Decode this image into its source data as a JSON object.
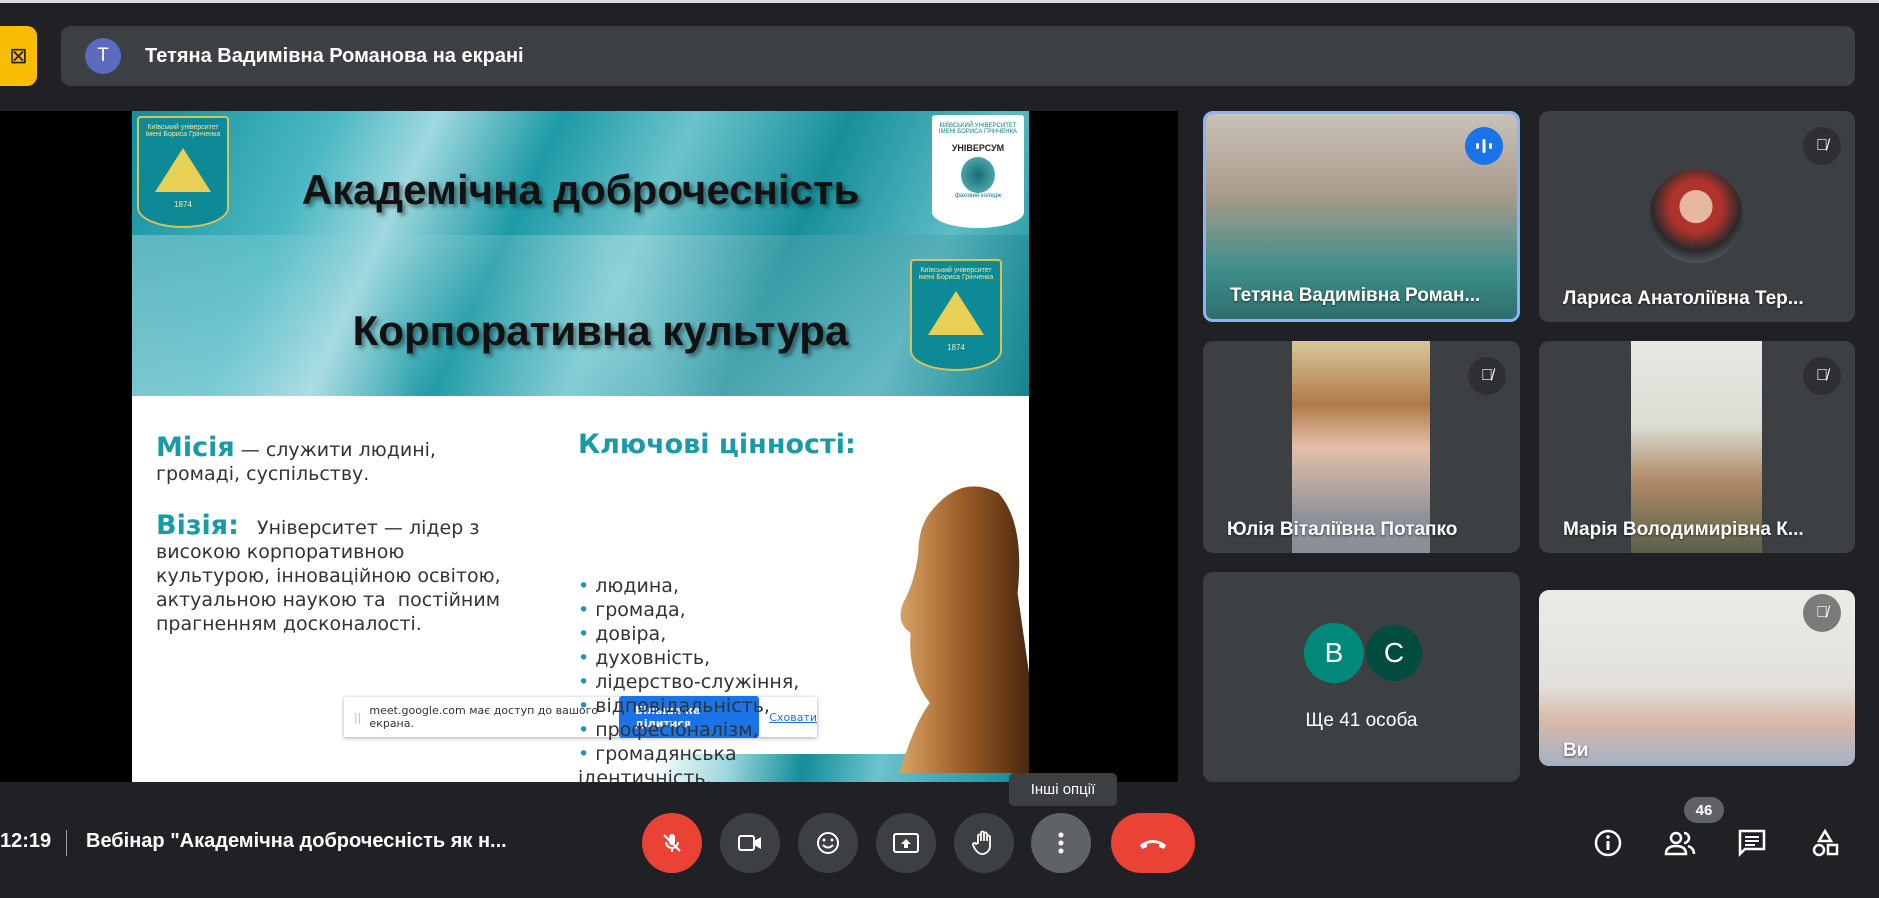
{
  "header": {
    "presenter_avatar_letter": "T",
    "presenter_banner": "Тетяна Вадимівна Романова на екрані"
  },
  "slide": {
    "title1": "Академічна доброчесність",
    "title2": "Корпоративна культура",
    "crest_text": "Київський університет імені Бориса Грінченка",
    "crest_year": "1874",
    "logo2_top": "КИЇВСЬКИЙ УНІВЕРСИТЕТ ІМЕНІ БОРИСА ГРІНЧЕНКА",
    "logo2_name": "УНІВЕРСУМ",
    "logo2_sub": "фаховий коледж",
    "mission_heading": "Місія",
    "mission_text": " — служити людині,",
    "mission_text2": "громаді, суспільству.",
    "vision_heading": "Візія:",
    "vision_lines": [
      "   Університет — лідер з",
      "високою корпоративною",
      "культурою, інноваційною освітою,",
      "актуальною наукою та  постійним",
      "прагненням досконалості."
    ],
    "values_heading": "Ключові цінності:",
    "values": [
      "людина,",
      "громада,",
      "довіра,",
      "духовність,",
      "лідерство-служіння,",
      "відповідальність,",
      "професіоналізм,",
      "громадянська"
    ],
    "values_tail": "ідентичність."
  },
  "share_popup": {
    "message": "meet.google.com має доступ до вашого екрана.",
    "stop_label": "Більше не ділитися",
    "hide_label": "Сховати"
  },
  "participants": [
    {
      "name": "Тетяна Вадимівна Роман..."
    },
    {
      "name": "Лариса Анатоліївна Тер..."
    },
    {
      "name": "Юлія Віталіївна Потапко"
    },
    {
      "name": "Марія Володимирівна К..."
    },
    {
      "avatars": [
        "B",
        "C"
      ],
      "more_label": "Ще 41 особа"
    },
    {
      "name": "Ви"
    }
  ],
  "bottom": {
    "time": "12:19",
    "meeting_title": "Вебінар \"Академічна доброчесність як н...",
    "tooltip": "Інші опції",
    "participant_count": "46"
  },
  "colors": {
    "accent": "#8ab4f8",
    "end_call": "#ea4335",
    "mic_off": "#ea4335",
    "present": "#fbbc04"
  }
}
